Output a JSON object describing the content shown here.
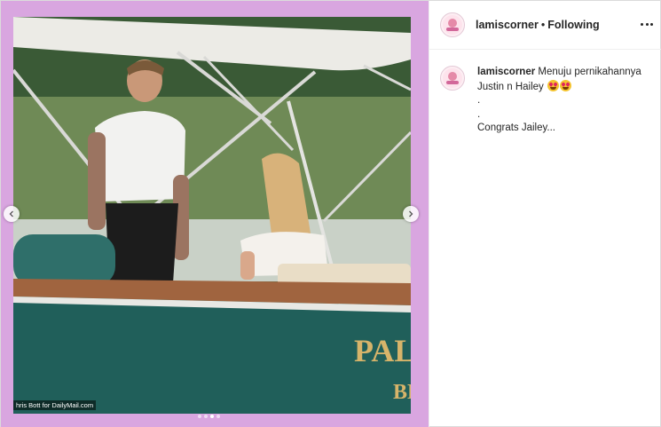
{
  "post": {
    "username": "lamiscorner",
    "separator": "•",
    "follow_status": "Following",
    "caption_lines": [
      "Menuju pernikahannya",
      "Justin n Hailey",
      ".",
      ".",
      "Congrats Jailey..."
    ],
    "photo_credit": "hris Bott for DailyMail.com",
    "boat_lettering": "PALM",
    "boat_lettering_2": "BL",
    "carousel": {
      "total": 4,
      "active_index": 2
    },
    "icons": {
      "prev": "chevron-left-icon",
      "next": "chevron-right-icon",
      "more": "more-options-icon",
      "avatar": "profile-avatar"
    },
    "colors": {
      "frame": "#d9a6e0",
      "text": "#262626",
      "border": "#efefef"
    }
  }
}
